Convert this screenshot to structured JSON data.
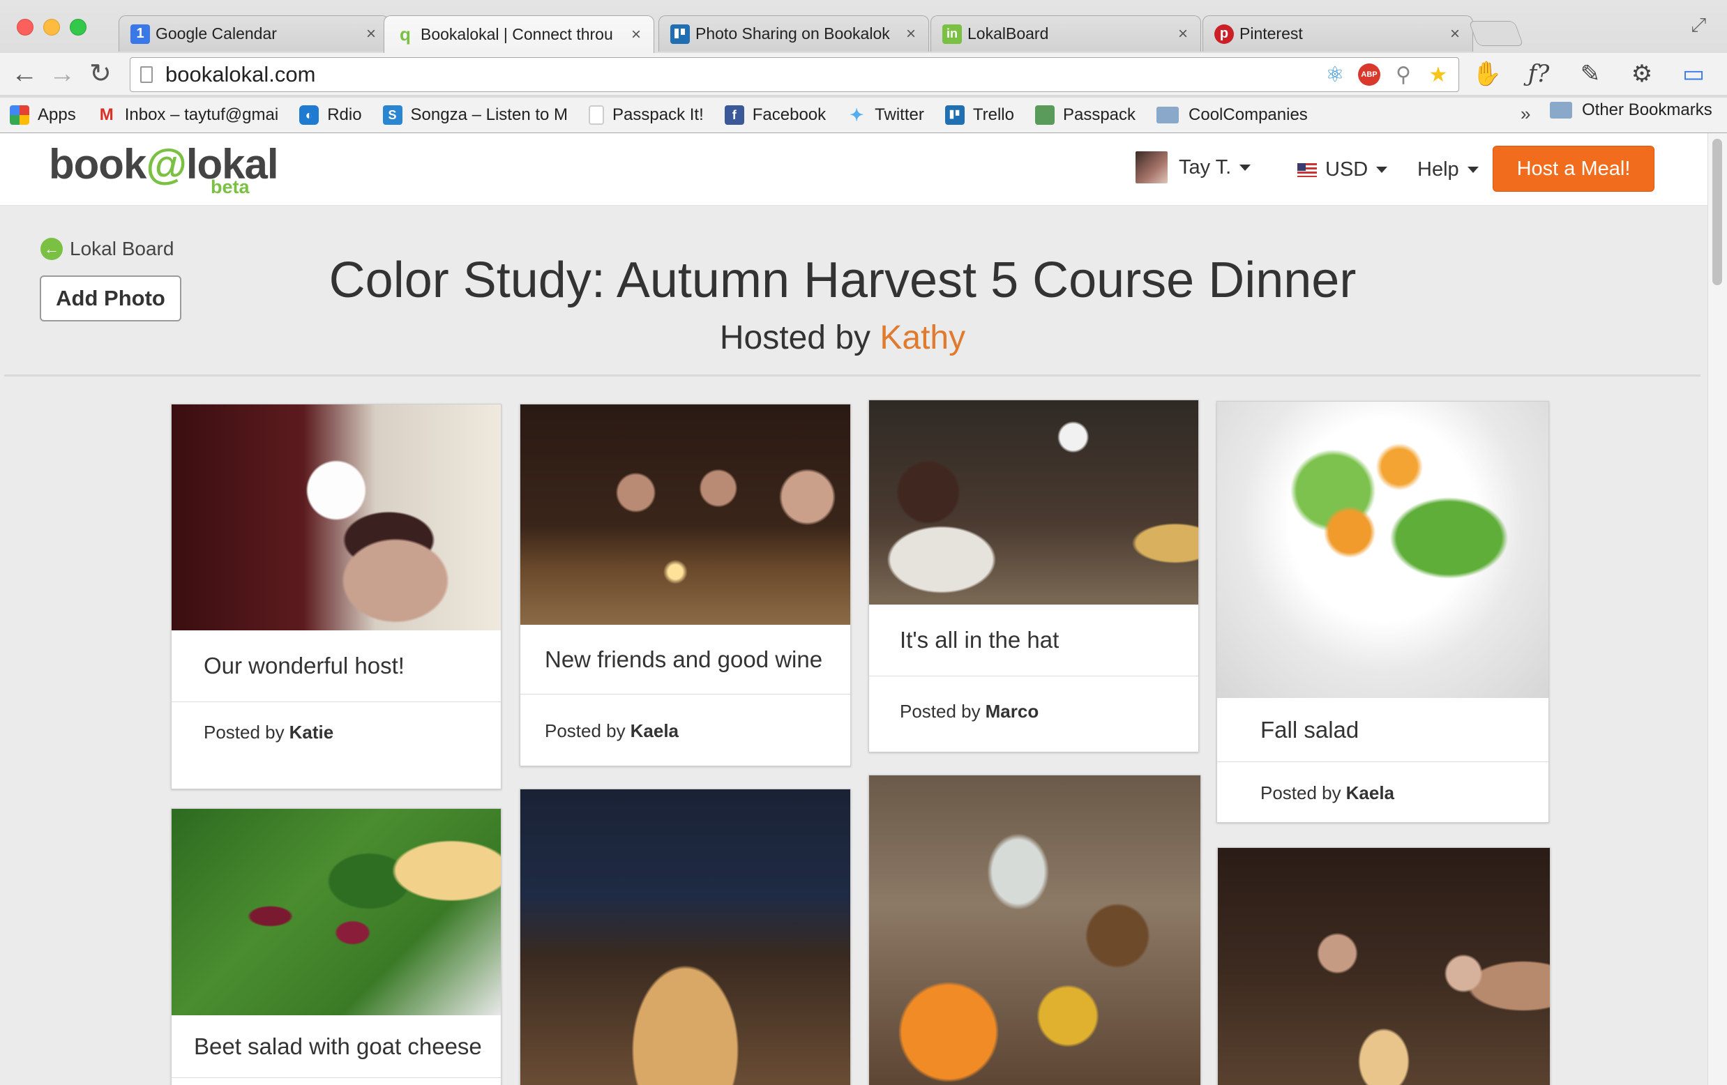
{
  "browser": {
    "tabs": [
      {
        "title": "Google Calendar",
        "favicon_text": "1",
        "favicon_color": "#3b78e7",
        "active": false
      },
      {
        "title": "Bookalokal | Connect throu",
        "favicon_text": "q",
        "favicon_color": "#7ac143",
        "active": true
      },
      {
        "title": "Photo Sharing on Bookalok",
        "favicon_text": "",
        "favicon_color": "#1f6fb2",
        "active": false
      },
      {
        "title": "LokalBoard",
        "favicon_text": "in",
        "favicon_color": "#7ac143",
        "active": false
      },
      {
        "title": "Pinterest",
        "favicon_text": "p",
        "favicon_color": "#cb2027",
        "active": false
      }
    ],
    "close_glyph": "×",
    "url": "bookalokal.com",
    "abp_label": "ABP",
    "bookmarks": [
      {
        "label": "Apps",
        "icon": "apps-grid-icon",
        "color": "#e34234"
      },
      {
        "label": "Inbox – taytuf@gmai",
        "icon": "gmail-icon",
        "color": "#d93025"
      },
      {
        "label": "Rdio",
        "icon": "rdio-icon",
        "color": "#1f7bd1"
      },
      {
        "label": "Songza – Listen to M",
        "icon": "songza-icon",
        "color": "#2a86d0"
      },
      {
        "label": "Passpack It!",
        "icon": "page-icon",
        "color": "#cccccc"
      },
      {
        "label": "Facebook",
        "icon": "facebook-icon",
        "color": "#3b5998"
      },
      {
        "label": "Twitter",
        "icon": "twitter-icon",
        "color": "#55acee"
      },
      {
        "label": "Trello",
        "icon": "trello-icon",
        "color": "#1f6fb2"
      },
      {
        "label": "Passpack",
        "icon": "passpack-icon",
        "color": "#5a9a5a"
      },
      {
        "label": "CoolCompanies",
        "icon": "folder-icon",
        "color": "#8aa8c9"
      }
    ],
    "bookmarks_more": "»",
    "other_bookmarks": "Other Bookmarks"
  },
  "site": {
    "logo_text_1": "book",
    "logo_at": "@",
    "logo_text_2": "lokal",
    "logo_beta": "beta",
    "user_name": "Tay T.",
    "currency": "USD",
    "help": "Help",
    "host_button": "Host a Meal!"
  },
  "event": {
    "back_label": "Lokal Board",
    "add_photo": "Add Photo",
    "title": "Color Study: Autumn Harvest 5 Course Dinner",
    "hosted_by_prefix": "Hosted by",
    "host_name": "Kathy"
  },
  "posted_by_prefix": "Posted by",
  "cards": [
    {
      "caption": "Our wonderful host!",
      "author": "Katie"
    },
    {
      "caption": "New friends and good wine",
      "author": "Kaela"
    },
    {
      "caption": "It's all in the hat",
      "author": "Marco"
    },
    {
      "caption": "Fall salad",
      "author": "Kaela"
    },
    {
      "caption": "Beet salad with goat cheese",
      "author": ""
    }
  ],
  "colors": {
    "accent_green": "#7ac143",
    "accent_orange": "#f26c1d",
    "host_name_orange": "#e07a2e"
  }
}
